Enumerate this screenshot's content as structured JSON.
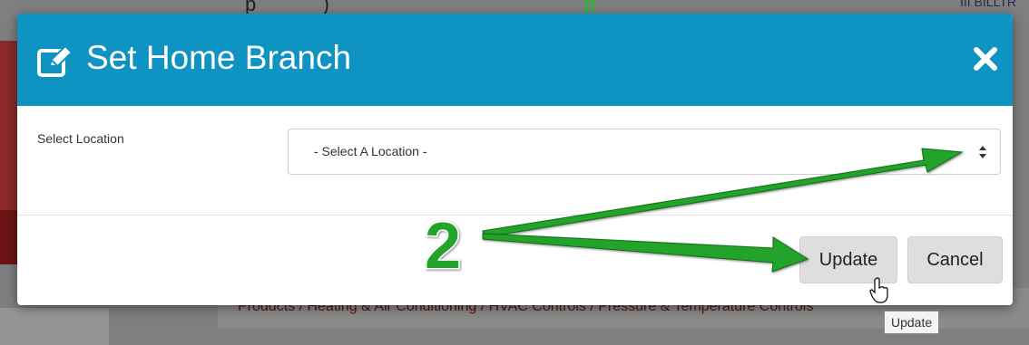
{
  "background": {
    "top_text_pre": "p",
    "top_text_gap": ")",
    "top_text_green": "p",
    "right_text": "III BILLTR",
    "breadcrumb": "Products  /  Heating & Air Conditioning  /  HVAC Controls  /  Pressure & Temperature Controls"
  },
  "modal": {
    "title": "Set Home Branch",
    "header_icon": "edit-icon",
    "close_icon": "close-icon",
    "field_label": "Select Location",
    "select": {
      "value": "- Select A Location -"
    },
    "buttons": {
      "update": "Update",
      "cancel": "Cancel"
    }
  },
  "annotation": {
    "number": "2",
    "tooltip": "Update"
  },
  "colors": {
    "header": "#0f93c2",
    "arrow": "#22a32a"
  }
}
